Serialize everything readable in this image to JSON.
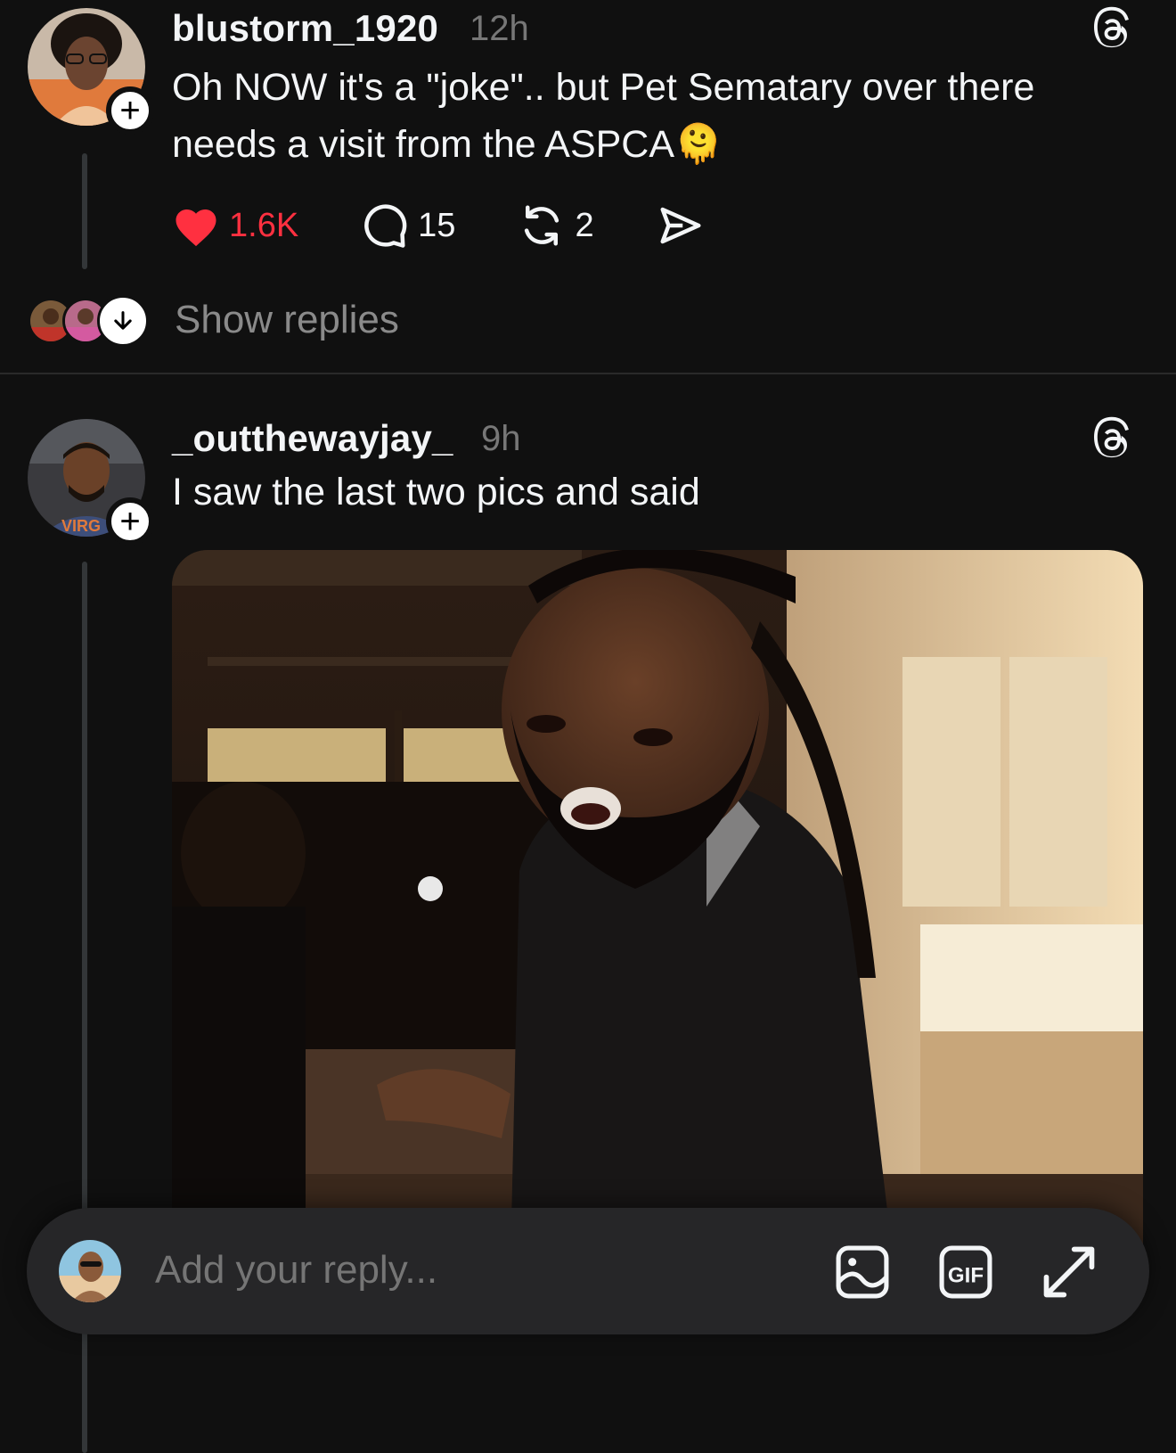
{
  "posts": [
    {
      "username": "blustorm_1920",
      "time": "12h",
      "text_line1": "Oh NOW it's a \"joke\".. but Pet Sematary over there",
      "text_line2": "needs a visit from the ASPCA",
      "emoji": "🫠",
      "likes": "1.6K",
      "replies": "15",
      "reposts": "2",
      "liked": true
    },
    {
      "username": "_outthewayjay_",
      "time": "9h",
      "text": "I saw the last two pics and said"
    }
  ],
  "show_replies_label": "Show replies",
  "composer": {
    "placeholder": "Add your reply..."
  },
  "colors": {
    "background": "#101010",
    "like_red": "#ff3040",
    "muted": "#777777"
  },
  "icons": [
    "threads-icon",
    "heart-icon",
    "comment-icon",
    "repost-icon",
    "share-icon",
    "arrow-down-icon",
    "image-icon",
    "gif-icon",
    "expand-icon"
  ]
}
